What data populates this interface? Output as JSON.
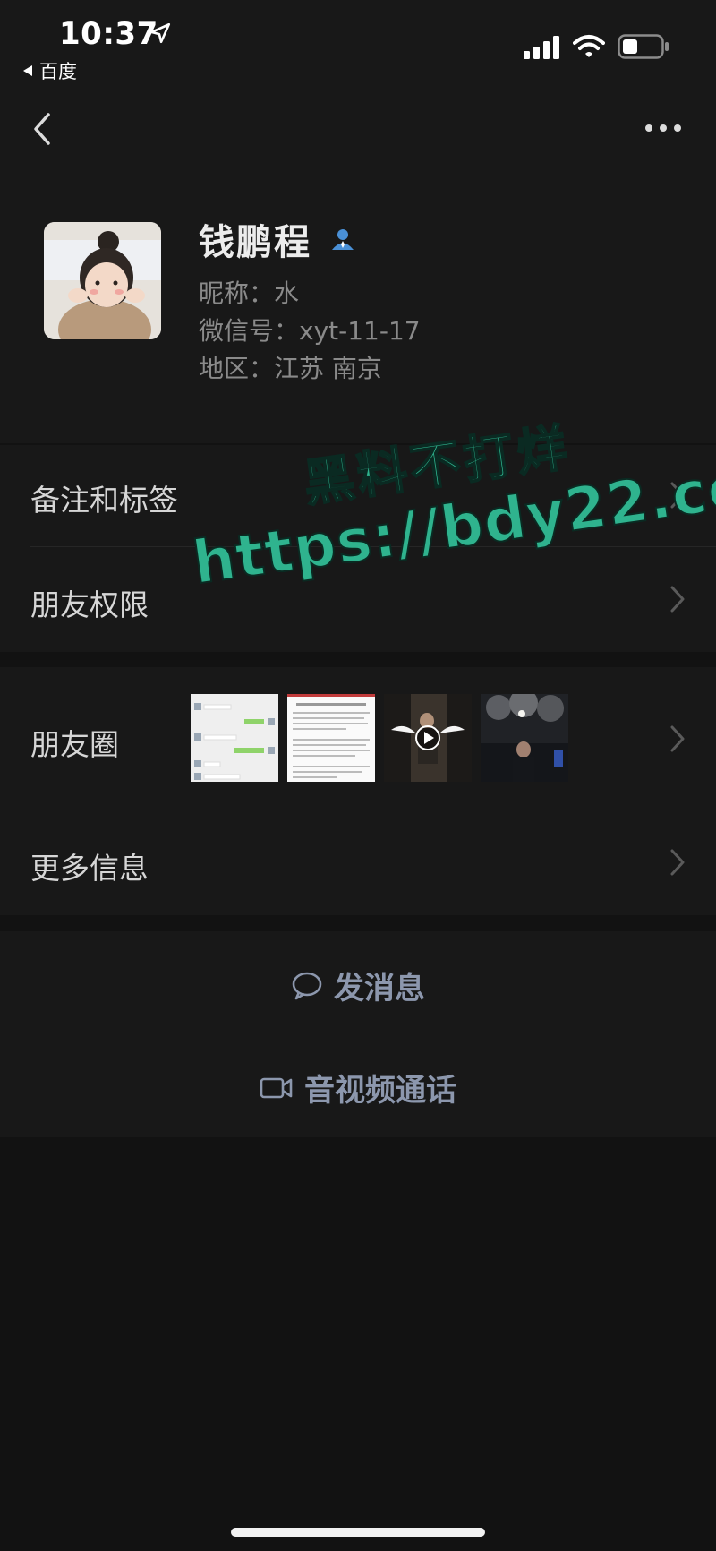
{
  "status_bar": {
    "time": "10:37",
    "back_app": "百度"
  },
  "nav": {
    "back_icon": "chevron-left-icon",
    "more_icon": "more-dots-icon"
  },
  "profile": {
    "name": "钱鹏程",
    "nickname": "昵称：水",
    "wechat_id": "微信号：xyt-11-17",
    "region": "地区：江苏 南京",
    "verified_icon": "user-icon"
  },
  "rows": {
    "remarks_tags": "备注和标签",
    "friend_permissions": "朋友权限",
    "moments": "朋友圈",
    "more_info": "更多信息"
  },
  "actions": {
    "send_message": "发消息",
    "video_call": "音视频通话"
  },
  "watermark": {
    "line1": "黑料不打烊",
    "line2": "https://bdy22.co"
  },
  "colors": {
    "background": "#121212",
    "card": "#181818",
    "action_text": "#8c97ad",
    "watermark": "#2fb38e"
  }
}
